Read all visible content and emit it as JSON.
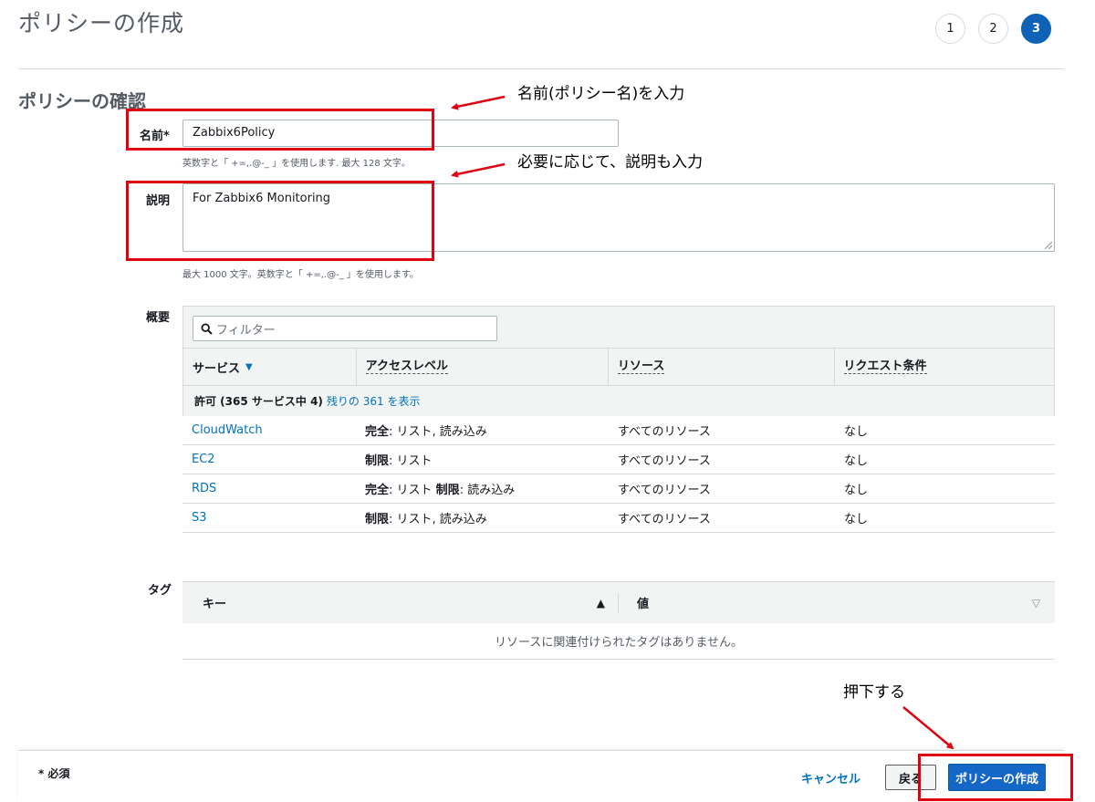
{
  "header": {
    "title": "ポリシーの作成",
    "steps": [
      "1",
      "2",
      "3"
    ],
    "active_step": "3"
  },
  "review": {
    "section_title": "ポリシーの確認",
    "name_label": "名前*",
    "name_value": "Zabbix6Policy",
    "name_hint": "英数字と「 +=,.@-_ 」を使用します. 最大 128 文字。",
    "description_label": "説明",
    "description_value": "For Zabbix6 Monitoring",
    "description_hint": "最大 1000 文字。英数字と「 +=,.@-_ 」を使用します。"
  },
  "summary": {
    "label": "概要",
    "filter_placeholder": "フィルター",
    "columns": [
      "サービス",
      "アクセスレベル",
      "リソース",
      "リクエスト条件"
    ],
    "group_label": "許可 (365 サービス中 4)",
    "group_link": "残りの 361 を表示",
    "rows": [
      {
        "service": "CloudWatch",
        "access_bold": "完全",
        "access_text": ": リスト, 読み込み",
        "access_bold2": "",
        "access_text2": "",
        "resource": "すべてのリソース",
        "condition": "なし"
      },
      {
        "service": "EC2",
        "access_bold": "制限",
        "access_text": ": リスト",
        "access_bold2": "",
        "access_text2": "",
        "resource": "すべてのリソース",
        "condition": "なし"
      },
      {
        "service": "RDS",
        "access_bold": "完全",
        "access_text": ": リスト ",
        "access_bold2": "制限",
        "access_text2": ": 読み込み",
        "resource": "すべてのリソース",
        "condition": "なし"
      },
      {
        "service": "S3",
        "access_bold": "制限",
        "access_text": ": リスト, 読み込み",
        "access_bold2": "",
        "access_text2": "",
        "resource": "すべてのリソース",
        "condition": "なし"
      }
    ]
  },
  "tags": {
    "label": "タグ",
    "key_header": "キー",
    "value_header": "値",
    "empty_message": "リソースに関連付けられたタグはありません。"
  },
  "footer": {
    "required_note": "* 必須",
    "cancel_label": "キャンセル",
    "back_label": "戻る",
    "create_label": "ポリシーの作成"
  },
  "annotations": {
    "name_note": "名前(ポリシー名)を入力",
    "description_note": "必要に応じて、説明も入力",
    "press_note": "押下する"
  },
  "colors": {
    "primary_button": "#1467c7",
    "link": "#0073bb",
    "annotation_red": "#e0000f"
  }
}
